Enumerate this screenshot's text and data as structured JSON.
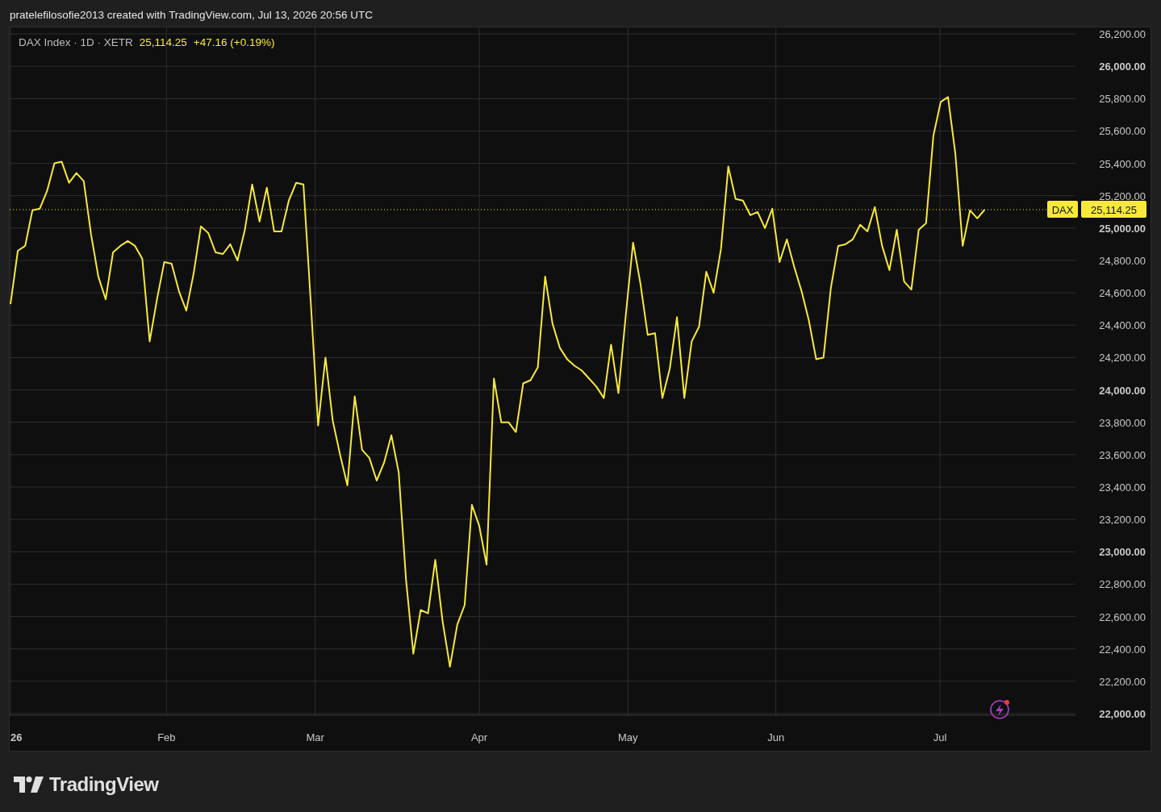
{
  "header": {
    "attribution": "pratelefilosofie2013 created with TradingView.com, Jul 13, 2026 20:56 UTC"
  },
  "legend": {
    "symbol": "DAX Index · 1D · XETR",
    "price": "25,114.25",
    "change": "+47.16 (+0.19%)"
  },
  "time_axis": [
    "26",
    "Feb",
    "Mar",
    "Apr",
    "May",
    "Jun",
    "Jul"
  ],
  "chart_data": {
    "type": "line",
    "grid": true,
    "ylim": [
      22000,
      26200
    ],
    "yticks": [
      {
        "value": 22000,
        "label": "22,000.00"
      },
      {
        "value": 22200,
        "label": "22,200.00"
      },
      {
        "value": 22400,
        "label": "22,400.00"
      },
      {
        "value": 22600,
        "label": "22,600.00"
      },
      {
        "value": 22800,
        "label": "22,800.00"
      },
      {
        "value": 23000,
        "label": "23,000.00"
      },
      {
        "value": 23200,
        "label": "23,200.00"
      },
      {
        "value": 23400,
        "label": "23,400.00"
      },
      {
        "value": 23600,
        "label": "23,600.00"
      },
      {
        "value": 23800,
        "label": "23,800.00"
      },
      {
        "value": 24000,
        "label": "24,000.00"
      },
      {
        "value": 24200,
        "label": "24,200.00"
      },
      {
        "value": 24400,
        "label": "24,400.00"
      },
      {
        "value": 24600,
        "label": "24,600.00"
      },
      {
        "value": 24800,
        "label": "24,800.00"
      },
      {
        "value": 25000,
        "label": "25,000.00"
      },
      {
        "value": 25200,
        "label": "25,200.00"
      },
      {
        "value": 25400,
        "label": "25,400.00"
      },
      {
        "value": 25600,
        "label": "25,600.00"
      },
      {
        "value": 25800,
        "label": "25,800.00"
      },
      {
        "value": 26000,
        "label": "26,000.00"
      },
      {
        "value": 26200,
        "label": "26,200.00"
      }
    ],
    "series": [
      {
        "name": "DAX",
        "color": "#f7e93b",
        "values": [
          24530,
          24860,
          24890,
          25110,
          25120,
          25230,
          25400,
          25410,
          25280,
          25340,
          25290,
          24960,
          24700,
          24560,
          24850,
          24890,
          24920,
          24890,
          24810,
          24300,
          24560,
          24790,
          24780,
          24610,
          24490,
          24720,
          25010,
          24970,
          24850,
          24840,
          24900,
          24800,
          24990,
          25270,
          25040,
          25250,
          24980,
          24980,
          25170,
          25280,
          25270,
          24540,
          23780,
          24200,
          23810,
          23600,
          23410,
          23960,
          23630,
          23580,
          23440,
          23550,
          23720,
          23490,
          22830,
          22370,
          22640,
          22620,
          22950,
          22570,
          22290,
          22550,
          22670,
          23290,
          23160,
          22920,
          24070,
          23800,
          23800,
          23740,
          24040,
          24060,
          24140,
          24700,
          24410,
          24260,
          24190,
          24150,
          24120,
          24070,
          24020,
          23950,
          24280,
          23980,
          24460,
          24910,
          24660,
          24340,
          24350,
          23950,
          24130,
          24450,
          23950,
          24300,
          24390,
          24730,
          24600,
          24870,
          25380,
          25180,
          25170,
          25080,
          25100,
          25000,
          25120,
          24790,
          24930,
          24760,
          24610,
          24430,
          24190,
          24200,
          24630,
          24890,
          24900,
          24930,
          25020,
          24980,
          25130,
          24890,
          24740,
          24990,
          24670,
          24620,
          24990,
          25030,
          25570,
          25780,
          25810,
          25460,
          24890,
          25110,
          25060,
          25114
        ]
      }
    ]
  },
  "price_label": {
    "value": "25,114.25"
  },
  "footer": {
    "logo_text": "TradingView"
  }
}
